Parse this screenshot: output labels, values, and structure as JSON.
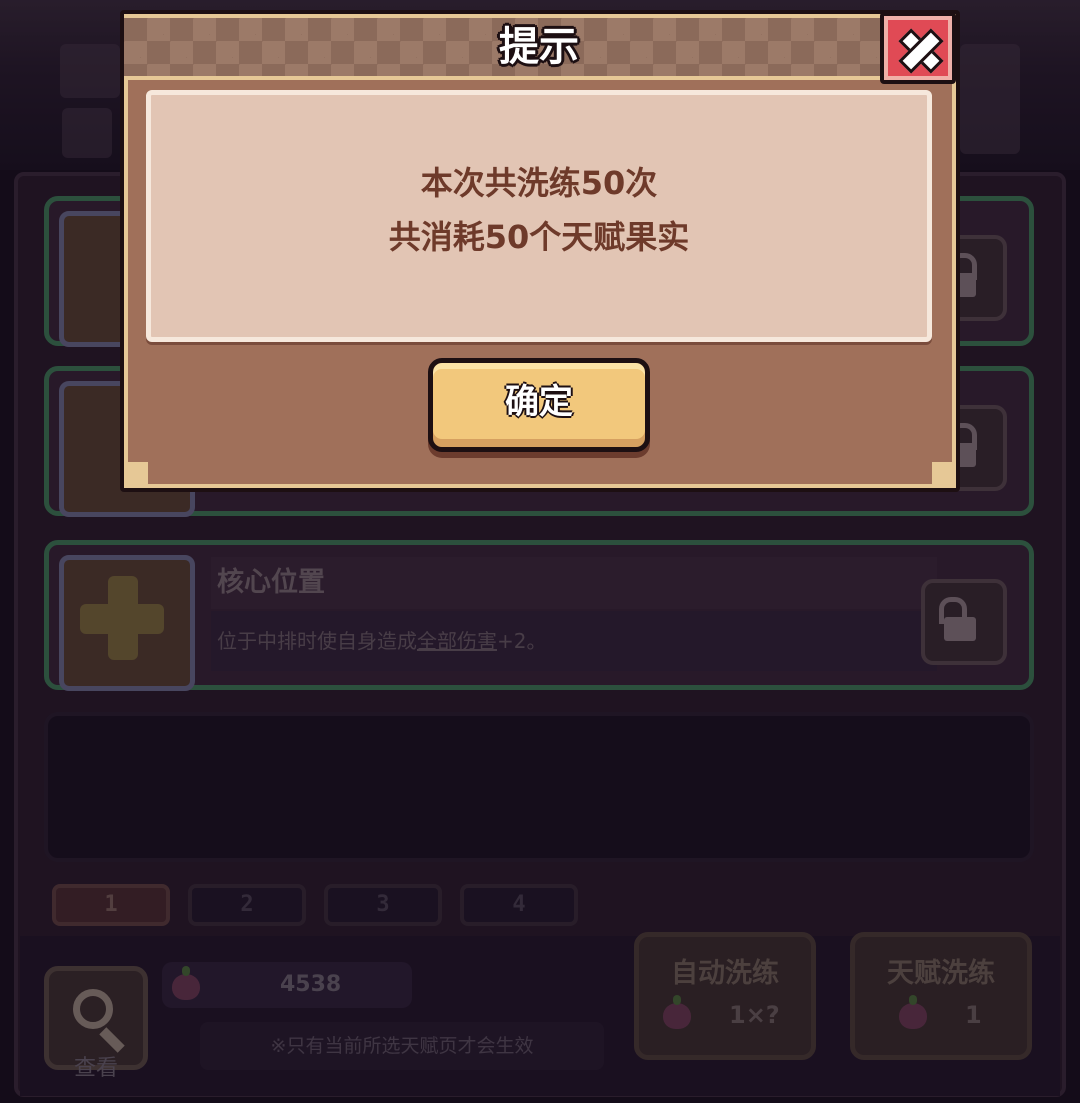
{
  "modal": {
    "title": "提示",
    "message_line1": "本次共洗练50次",
    "message_line2": "共消耗50个天赋果实",
    "confirm_label": "确定",
    "close_icon": "close-icon"
  },
  "talent": {
    "name": "核心位置",
    "desc_prefix": "位于中排时使自身造成",
    "desc_link": "全部伤害",
    "desc_suffix": "+2。"
  },
  "pages": [
    "1",
    "2",
    "3",
    "4"
  ],
  "resources": {
    "fruit_count": "4538",
    "note": "※只有当前所选天赋页才会生效",
    "search_label": "查看"
  },
  "actions": {
    "auto": {
      "label": "自动洗练",
      "cost": "1×?"
    },
    "talent": {
      "label": "天赋洗练",
      "cost": "1"
    }
  },
  "colors": {
    "accent_gold": "#f2c87c",
    "close_red": "#e04a55",
    "message_brown": "#6e3a2a"
  }
}
